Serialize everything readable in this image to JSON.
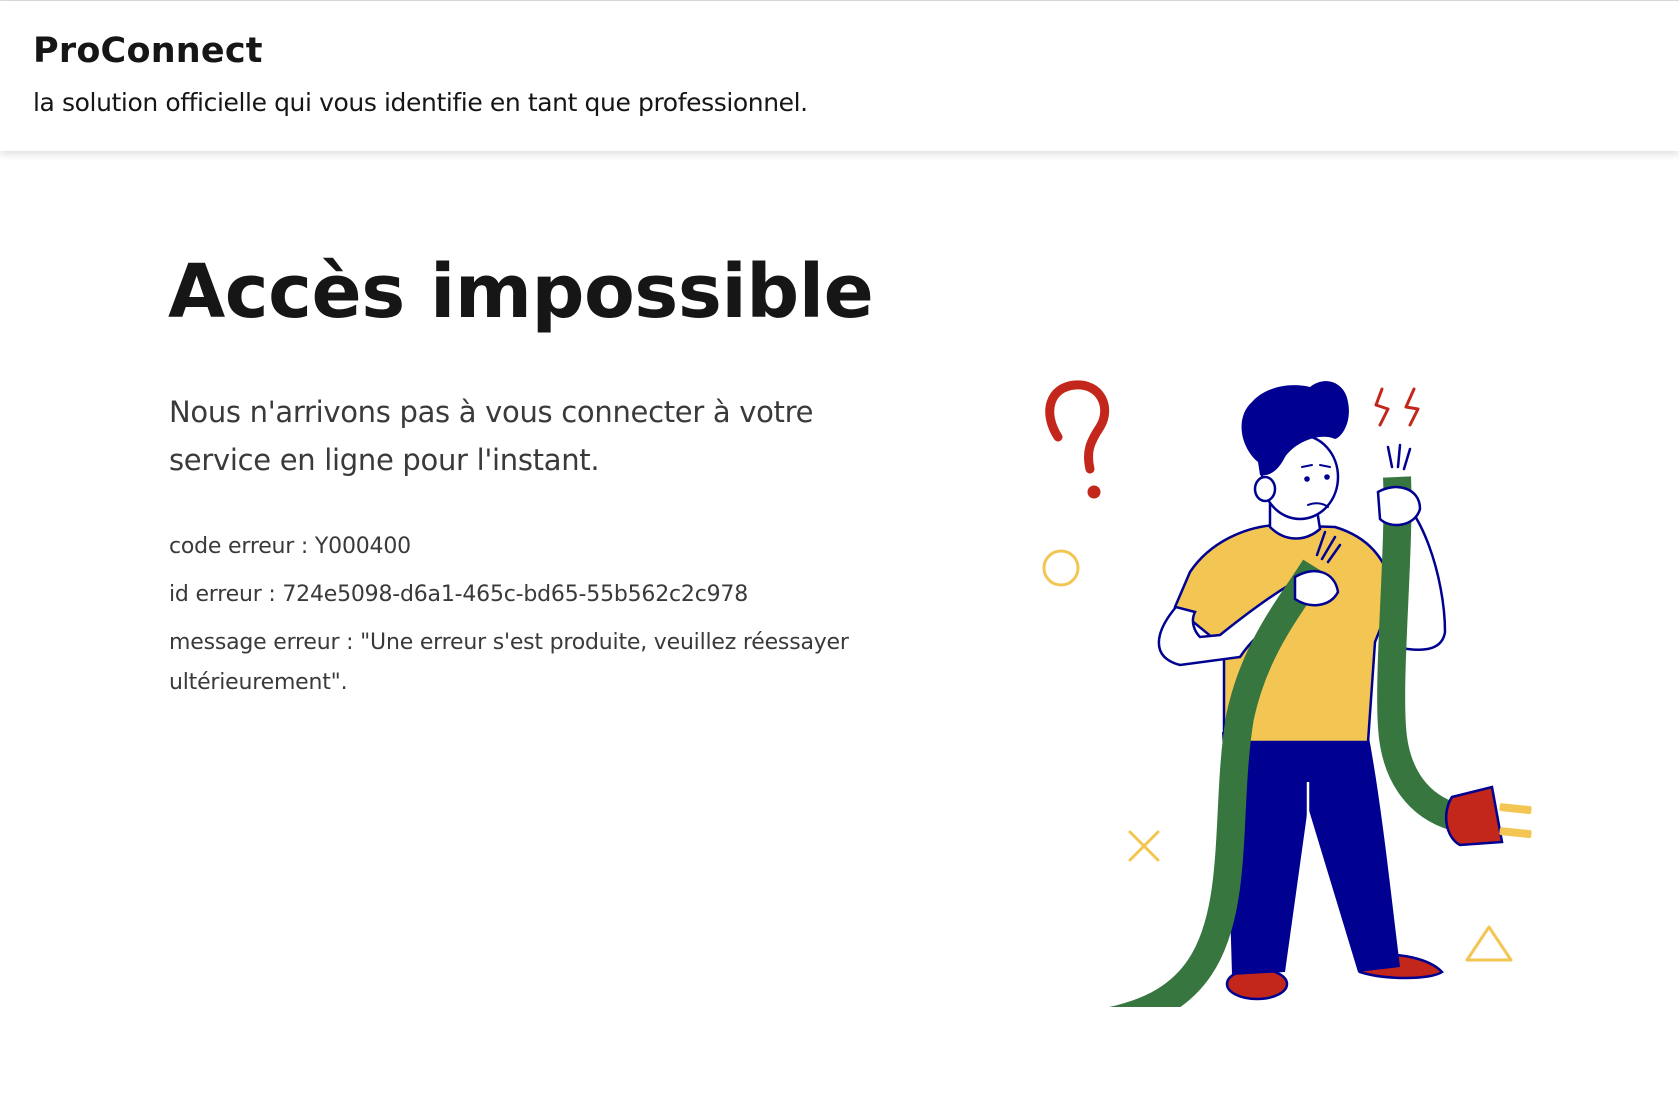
{
  "header": {
    "brand": "ProConnect",
    "tagline": "la solution officielle qui vous identifie en tant que professionnel."
  },
  "main": {
    "title": "Accès impossible",
    "lead": "Nous n'arrivons pas à vous connecter à votre service en ligne pour l'instant.",
    "error_code": "code erreur : Y000400",
    "error_id": "id erreur : 724e5098-d6a1-465c-bd65-55b562c2c978",
    "error_message": "message erreur : \"Une erreur s'est produite, veuillez réessayer ultérieurement\"."
  },
  "illustration": {
    "subject": "person holding a cut cable",
    "colors": {
      "hair_pants": "#000091",
      "shirt": "#F3C654",
      "cable": "#37773F",
      "accent_red": "#C3261B",
      "shapes_yellow": "#F3C654"
    }
  }
}
